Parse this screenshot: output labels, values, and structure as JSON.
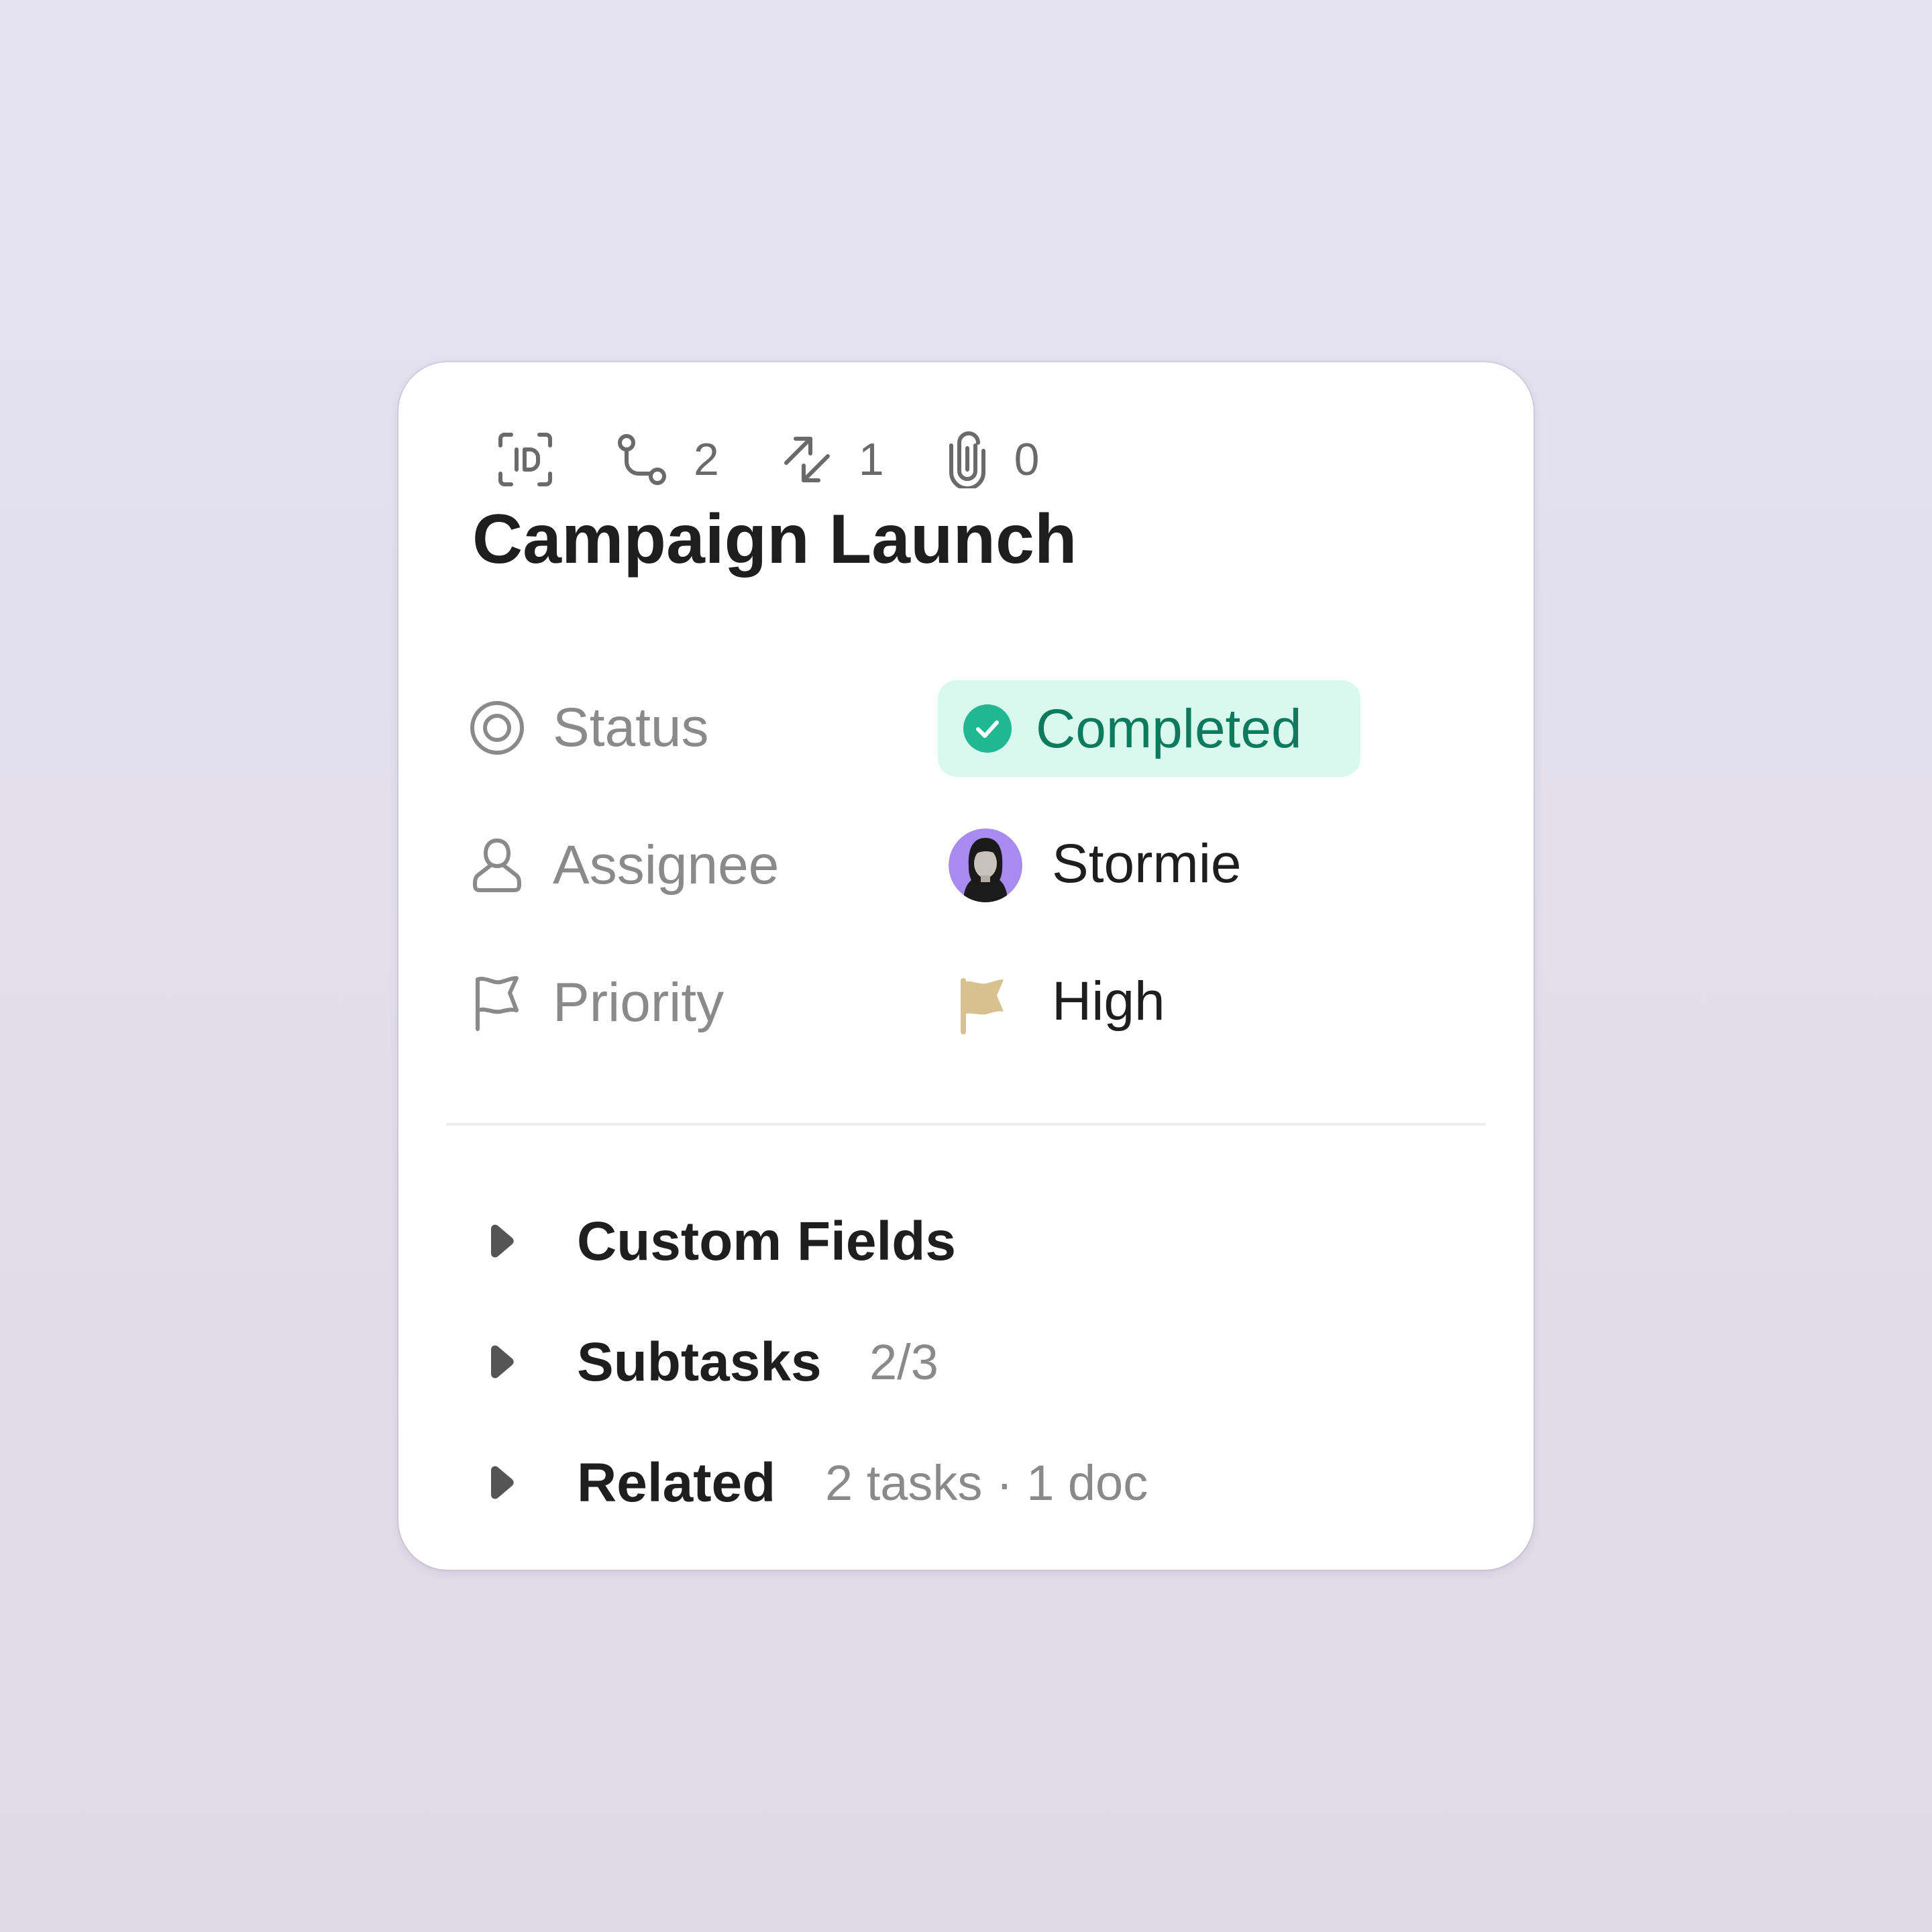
{
  "card": {
    "meta": {
      "id_icon": "id-icon",
      "subtasks_icon": "route-icon",
      "subtasks_count": "2",
      "links_icon": "arrows-swap-icon",
      "links_count": "1",
      "attachments_icon": "paperclip-icon",
      "attachments_count": "0"
    },
    "title": "Campaign Launch",
    "properties": {
      "status": {
        "label": "Status",
        "icon": "target-icon",
        "value": "Completed",
        "value_icon": "check-circle-icon",
        "color": "#0c7a5c",
        "background": "#d9f8ee"
      },
      "assignee": {
        "label": "Assignee",
        "icon": "person-icon",
        "value": "Stormie",
        "avatar_color": "#a78bf0"
      },
      "priority": {
        "label": "Priority",
        "icon": "flag-outline-icon",
        "value": "High",
        "value_icon": "flag-filled-icon",
        "color": "#d9c08f"
      }
    },
    "sections": [
      {
        "title": "Custom Fields",
        "meta": ""
      },
      {
        "title": "Subtasks",
        "meta": "2/3"
      },
      {
        "title": "Related",
        "meta": "2 tasks · 1 doc"
      }
    ]
  }
}
